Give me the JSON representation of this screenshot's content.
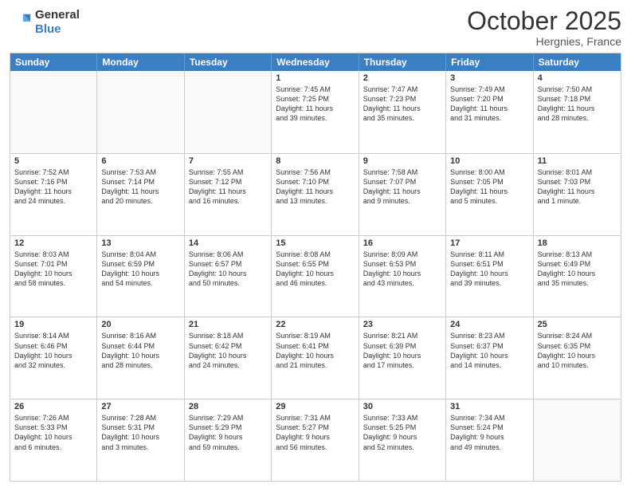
{
  "header": {
    "logo_line1": "General",
    "logo_line2": "Blue",
    "month": "October 2025",
    "location": "Hergnies, France"
  },
  "weekdays": [
    "Sunday",
    "Monday",
    "Tuesday",
    "Wednesday",
    "Thursday",
    "Friday",
    "Saturday"
  ],
  "weeks": [
    [
      {
        "day": "",
        "text": ""
      },
      {
        "day": "",
        "text": ""
      },
      {
        "day": "",
        "text": ""
      },
      {
        "day": "1",
        "text": "Sunrise: 7:45 AM\nSunset: 7:25 PM\nDaylight: 11 hours\nand 39 minutes."
      },
      {
        "day": "2",
        "text": "Sunrise: 7:47 AM\nSunset: 7:23 PM\nDaylight: 11 hours\nand 35 minutes."
      },
      {
        "day": "3",
        "text": "Sunrise: 7:49 AM\nSunset: 7:20 PM\nDaylight: 11 hours\nand 31 minutes."
      },
      {
        "day": "4",
        "text": "Sunrise: 7:50 AM\nSunset: 7:18 PM\nDaylight: 11 hours\nand 28 minutes."
      }
    ],
    [
      {
        "day": "5",
        "text": "Sunrise: 7:52 AM\nSunset: 7:16 PM\nDaylight: 11 hours\nand 24 minutes."
      },
      {
        "day": "6",
        "text": "Sunrise: 7:53 AM\nSunset: 7:14 PM\nDaylight: 11 hours\nand 20 minutes."
      },
      {
        "day": "7",
        "text": "Sunrise: 7:55 AM\nSunset: 7:12 PM\nDaylight: 11 hours\nand 16 minutes."
      },
      {
        "day": "8",
        "text": "Sunrise: 7:56 AM\nSunset: 7:10 PM\nDaylight: 11 hours\nand 13 minutes."
      },
      {
        "day": "9",
        "text": "Sunrise: 7:58 AM\nSunset: 7:07 PM\nDaylight: 11 hours\nand 9 minutes."
      },
      {
        "day": "10",
        "text": "Sunrise: 8:00 AM\nSunset: 7:05 PM\nDaylight: 11 hours\nand 5 minutes."
      },
      {
        "day": "11",
        "text": "Sunrise: 8:01 AM\nSunset: 7:03 PM\nDaylight: 11 hours\nand 1 minute."
      }
    ],
    [
      {
        "day": "12",
        "text": "Sunrise: 8:03 AM\nSunset: 7:01 PM\nDaylight: 10 hours\nand 58 minutes."
      },
      {
        "day": "13",
        "text": "Sunrise: 8:04 AM\nSunset: 6:59 PM\nDaylight: 10 hours\nand 54 minutes."
      },
      {
        "day": "14",
        "text": "Sunrise: 8:06 AM\nSunset: 6:57 PM\nDaylight: 10 hours\nand 50 minutes."
      },
      {
        "day": "15",
        "text": "Sunrise: 8:08 AM\nSunset: 6:55 PM\nDaylight: 10 hours\nand 46 minutes."
      },
      {
        "day": "16",
        "text": "Sunrise: 8:09 AM\nSunset: 6:53 PM\nDaylight: 10 hours\nand 43 minutes."
      },
      {
        "day": "17",
        "text": "Sunrise: 8:11 AM\nSunset: 6:51 PM\nDaylight: 10 hours\nand 39 minutes."
      },
      {
        "day": "18",
        "text": "Sunrise: 8:13 AM\nSunset: 6:49 PM\nDaylight: 10 hours\nand 35 minutes."
      }
    ],
    [
      {
        "day": "19",
        "text": "Sunrise: 8:14 AM\nSunset: 6:46 PM\nDaylight: 10 hours\nand 32 minutes."
      },
      {
        "day": "20",
        "text": "Sunrise: 8:16 AM\nSunset: 6:44 PM\nDaylight: 10 hours\nand 28 minutes."
      },
      {
        "day": "21",
        "text": "Sunrise: 8:18 AM\nSunset: 6:42 PM\nDaylight: 10 hours\nand 24 minutes."
      },
      {
        "day": "22",
        "text": "Sunrise: 8:19 AM\nSunset: 6:41 PM\nDaylight: 10 hours\nand 21 minutes."
      },
      {
        "day": "23",
        "text": "Sunrise: 8:21 AM\nSunset: 6:39 PM\nDaylight: 10 hours\nand 17 minutes."
      },
      {
        "day": "24",
        "text": "Sunrise: 8:23 AM\nSunset: 6:37 PM\nDaylight: 10 hours\nand 14 minutes."
      },
      {
        "day": "25",
        "text": "Sunrise: 8:24 AM\nSunset: 6:35 PM\nDaylight: 10 hours\nand 10 minutes."
      }
    ],
    [
      {
        "day": "26",
        "text": "Sunrise: 7:26 AM\nSunset: 5:33 PM\nDaylight: 10 hours\nand 6 minutes."
      },
      {
        "day": "27",
        "text": "Sunrise: 7:28 AM\nSunset: 5:31 PM\nDaylight: 10 hours\nand 3 minutes."
      },
      {
        "day": "28",
        "text": "Sunrise: 7:29 AM\nSunset: 5:29 PM\nDaylight: 9 hours\nand 59 minutes."
      },
      {
        "day": "29",
        "text": "Sunrise: 7:31 AM\nSunset: 5:27 PM\nDaylight: 9 hours\nand 56 minutes."
      },
      {
        "day": "30",
        "text": "Sunrise: 7:33 AM\nSunset: 5:25 PM\nDaylight: 9 hours\nand 52 minutes."
      },
      {
        "day": "31",
        "text": "Sunrise: 7:34 AM\nSunset: 5:24 PM\nDaylight: 9 hours\nand 49 minutes."
      },
      {
        "day": "",
        "text": ""
      }
    ]
  ]
}
